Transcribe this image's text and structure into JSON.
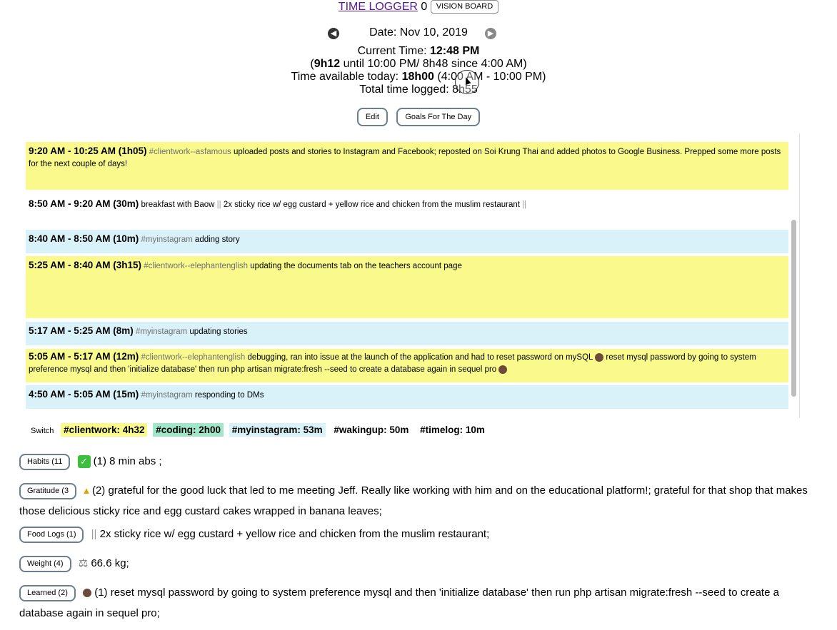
{
  "header": {
    "app_title": "TIME LOGGER",
    "count": "0",
    "vision_board_label": "VISION BOARD"
  },
  "date_nav": {
    "date_label": "Date: Nov 10, 2019"
  },
  "info": {
    "current_time_label": "Current Time: ",
    "current_time_value": "12:48 PM",
    "remaining_open": "(",
    "remaining_value": "9h12",
    "remaining_rest": " until 10:00 PM/ 8h48 since 4:00 AM)",
    "available_label": "Time available today: ",
    "available_value": "18h00",
    "available_rest": " (4:00 AM - 10:00 PM)",
    "total_logged": "Total time logged: 8h55"
  },
  "actions": {
    "edit_label": "Edit",
    "goals_label": "Goals For The Day"
  },
  "entries": [
    {
      "time": "9:20 AM - 10:25 AM (1h05)",
      "tag": "#clientwork--asfamous",
      "text": "uploaded posts and stories to Instagram and Facebook; reposted on Soi Krung Thai and added photos to Google Business. Prepped some more posts for the next couple of days!",
      "color": "yellow"
    },
    {
      "time": "8:50 AM - 9:20 AM (30m)",
      "tag": "",
      "text": "breakfast with Baow",
      "text2": "2x sticky rice w/ egg custard + yellow rice and chicken from the muslim restaurant",
      "color": "white"
    },
    {
      "time": "8:40 AM - 8:50 AM (10m)",
      "tag": "#myinstagram",
      "text": "adding story",
      "color": "blue"
    },
    {
      "time": "5:25 AM - 8:40 AM (3h15)",
      "tag": "#clientwork--elephantenglish",
      "text": "updating the documents tab on the teachers account page",
      "color": "yellow"
    },
    {
      "time": "5:17 AM - 5:25 AM (8m)",
      "tag": "#myinstagram",
      "text": "updating stories",
      "color": "blue"
    },
    {
      "time": "5:05 AM - 5:17 AM (12m)",
      "tag": "#clientwork--elephantenglish",
      "text": "debugging, ran into issue at the launch of the application and had to reset password on mySQL",
      "text2": "reset mysql password by going to system preference mysql and then 'initialize database' then run php artisan migrate:fresh --seed to create a database again in sequel pro",
      "color": "yellow"
    },
    {
      "time": "4:50 AM - 5:05 AM (15m)",
      "tag": "#myinstagram",
      "text": "responding to DMs",
      "color": "blue"
    }
  ],
  "tagbar": {
    "switch_label": "Switch",
    "tags": [
      {
        "label": "#clientwork: 4h32",
        "color": "#fafa8c"
      },
      {
        "label": "#coding: 2h00",
        "color": "#a0e6c8"
      },
      {
        "label": "#myinstagram: 53m",
        "color": "#d9f1f9"
      },
      {
        "label": "#wakingup: 50m",
        "color": "#ffffff"
      },
      {
        "label": "#timelog: 10m",
        "color": "#ffffff"
      }
    ]
  },
  "sections": {
    "habits": {
      "button": "Habits (11",
      "icon": "check-icon",
      "text": "(1) 8 min abs ;"
    },
    "gratitude": {
      "button": "Gratitude (3",
      "icon": "praying-hands-icon",
      "text": "(2) grateful for the good luck that led to me meeting Jeff. Really like working with him and on the educational platform!; grateful for that shop that makes those delicious sticky rice and egg custard cakes wrapped in banana leaves;"
    },
    "food": {
      "button": "Food Logs (1)",
      "icon": "fork-knife-icon",
      "text": "2x sticky rice w/ egg custard + yellow rice and chicken from the muslim restaurant;"
    },
    "weight": {
      "button": "Weight (4)",
      "icon": "scale-icon",
      "text": "66.6 kg;"
    },
    "learned": {
      "button": "Learned (2)",
      "icon": "person-icon",
      "text": "(1) reset mysql password by going to system preference mysql and then 'initialize database' then run php artisan migrate:fresh --seed to create a database again in sequel pro;"
    }
  }
}
